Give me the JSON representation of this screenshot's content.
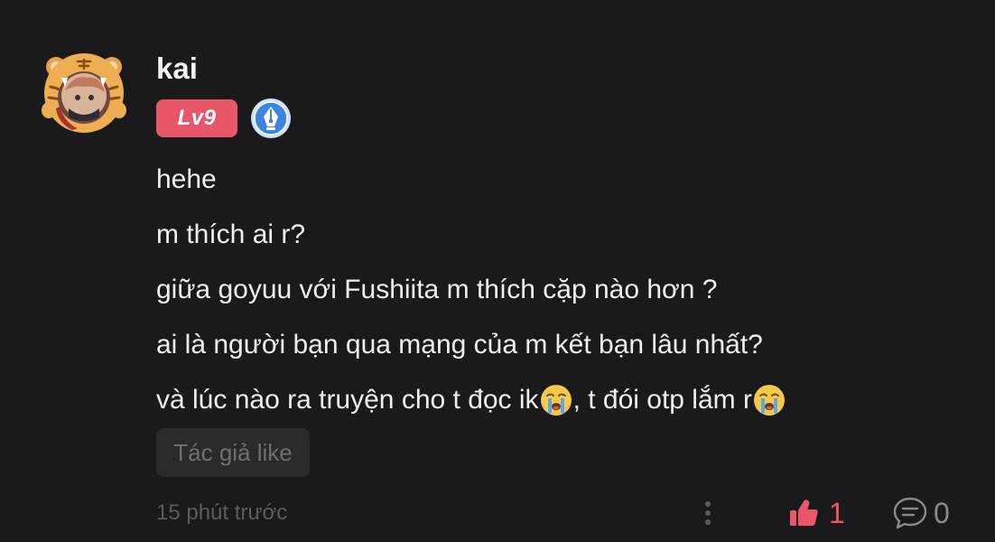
{
  "comment": {
    "username": "kai",
    "level": "Lv9",
    "lines": [
      "hehe",
      "m thích ai r?",
      "giữa goyuu với Fushiita m thích cặp nào hơn ?",
      "ai là người bạn qua mạng của m kết bạn lâu nhất?"
    ],
    "last_line": {
      "part1": "và lúc nào ra truyện cho t đọc ik",
      "part2": ", t đói otp lắm r"
    },
    "author_like_label": "Tác giả like",
    "timestamp": "15 phút trước",
    "like_count": "1",
    "reply_count": "0"
  },
  "icons": {
    "author": "pen-nib-badge-icon",
    "emoji": "loudly-crying-face-icon",
    "more": "more-vertical-icon",
    "like": "thumbs-up-icon",
    "reply": "comment-bubble-icon"
  },
  "colors": {
    "background": "#1a191c",
    "accent": "#e8566a",
    "author_badge": "#3b84e0",
    "muted_text": "#5c5b60"
  }
}
